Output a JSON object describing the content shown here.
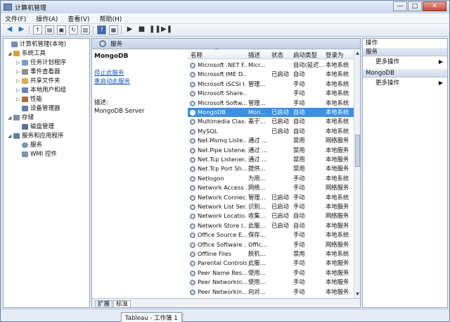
{
  "window": {
    "title": "计算机管理",
    "min": "—",
    "max": "□",
    "close": "✕"
  },
  "menu": [
    "文件(F)",
    "操作(A)",
    "查看(V)",
    "帮助(H)"
  ],
  "tree": [
    {
      "label": "计算机管理(本地)",
      "color": "#6d8bb8",
      "expander": ""
    },
    {
      "label": "系统工具",
      "color": "#d6a43c",
      "expander": "◢"
    },
    {
      "label": "任务计划程序",
      "color": "#7b9bcc",
      "expander": "▷"
    },
    {
      "label": "事件查看器",
      "color": "#8c8c8c",
      "expander": "▷"
    },
    {
      "label": "共享文件夹",
      "color": "#d3b14a",
      "expander": "▷"
    },
    {
      "label": "本地用户和组",
      "color": "#6b86b3",
      "expander": "▷"
    },
    {
      "label": "性能",
      "color": "#b06b3d",
      "expander": "▷"
    },
    {
      "label": "设备管理器",
      "color": "#5f7fa8",
      "expander": ""
    },
    {
      "label": "存储",
      "color": "#7e8fa6",
      "expander": "◢"
    },
    {
      "label": "磁盘管理",
      "color": "#5b7290",
      "expander": ""
    },
    {
      "label": "服务和应用程序",
      "color": "#6a7e9b",
      "expander": "◢"
    },
    {
      "label": "服务",
      "color": "#7f94ad",
      "expander": ""
    },
    {
      "label": "WMI 控件",
      "color": "#7f94ad",
      "expander": ""
    }
  ],
  "center": {
    "header": "服务",
    "selected_name": "MongoDB",
    "stop_link": "停止此服务",
    "restart_link": "重启动此服务",
    "desc_label": "描述:",
    "desc_value": "MongoDB Server",
    "columns": {
      "name": "名称",
      "desc": "描述",
      "status": "状态",
      "startup": "启动类型",
      "logon": "登录为"
    },
    "sort_indicator": "^",
    "rows": [
      {
        "name": "Microsoft .NET F...",
        "desc": "Micr...",
        "status": "",
        "startup": "自动(延迟...",
        "logon": "本地系统"
      },
      {
        "name": "Microsoft IME D...",
        "desc": "",
        "status": "已启动",
        "startup": "自动",
        "logon": "本地系统"
      },
      {
        "name": "Microsoft iSCSI I...",
        "desc": "管理...",
        "status": "",
        "startup": "手动",
        "logon": "本地系统"
      },
      {
        "name": "Microsoft Share...",
        "desc": "",
        "status": "",
        "startup": "手动",
        "logon": "本地系统"
      },
      {
        "name": "Microsoft Softw...",
        "desc": "管理...",
        "status": "",
        "startup": "手动",
        "logon": "本地系统"
      },
      {
        "name": "MongoDB",
        "desc": "Mon...",
        "status": "已启动",
        "startup": "自动",
        "logon": "本地系统",
        "selected": true
      },
      {
        "name": "Multimedia Clas...",
        "desc": "基于...",
        "status": "已启动",
        "startup": "自动",
        "logon": "本地系统"
      },
      {
        "name": "MySQL",
        "desc": "",
        "status": "已启动",
        "startup": "自动",
        "logon": "本地系统"
      },
      {
        "name": "Net.Msmq Liste...",
        "desc": "通过 ...",
        "status": "",
        "startup": "禁用",
        "logon": "网络服务"
      },
      {
        "name": "Net.Pipe Listene...",
        "desc": "通过 ...",
        "status": "",
        "startup": "禁用",
        "logon": "本地服务"
      },
      {
        "name": "Net.Tcp Listener...",
        "desc": "通过 ...",
        "status": "",
        "startup": "禁用",
        "logon": "本地服务"
      },
      {
        "name": "Net.Tcp Port Sh...",
        "desc": "提供...",
        "status": "",
        "startup": "禁用",
        "logon": "本地服务"
      },
      {
        "name": "Netlogon",
        "desc": "为用...",
        "status": "",
        "startup": "手动",
        "logon": "本地系统"
      },
      {
        "name": "Network Access ...",
        "desc": "网络...",
        "status": "",
        "startup": "手动",
        "logon": "网络服务"
      },
      {
        "name": "Network Connec...",
        "desc": "管理...",
        "status": "已启动",
        "startup": "手动",
        "logon": "本地系统"
      },
      {
        "name": "Network List Ser...",
        "desc": "识别...",
        "status": "已启动",
        "startup": "手动",
        "logon": "本地服务"
      },
      {
        "name": "Network Locatio...",
        "desc": "收集...",
        "status": "已启动",
        "startup": "自动",
        "logon": "网络服务"
      },
      {
        "name": "Network Store I...",
        "desc": "此服...",
        "status": "已启动",
        "startup": "自动",
        "logon": "本地服务"
      },
      {
        "name": "Office  Source E...",
        "desc": "保存...",
        "status": "",
        "startup": "手动",
        "logon": "本地系统"
      },
      {
        "name": "Office Software ...",
        "desc": "Offic...",
        "status": "",
        "startup": "手动",
        "logon": "网络服务"
      },
      {
        "name": "Offline Files",
        "desc": "脱机...",
        "status": "",
        "startup": "禁用",
        "logon": "本地系统"
      },
      {
        "name": "Parental Controls",
        "desc": "此服...",
        "status": "",
        "startup": "手动",
        "logon": "本地服务"
      },
      {
        "name": "Peer Name Res...",
        "desc": "使用...",
        "status": "",
        "startup": "手动",
        "logon": "本地服务"
      },
      {
        "name": "Peer Networkin...",
        "desc": "使用...",
        "status": "",
        "startup": "手动",
        "logon": "本地服务"
      },
      {
        "name": "Peer Networkin...",
        "desc": "向对...",
        "status": "",
        "startup": "手动",
        "logon": "本地服务"
      }
    ],
    "tabs": [
      "扩展",
      "标准"
    ]
  },
  "actions": {
    "title": "操作",
    "sections": [
      {
        "header": "服务",
        "items": [
          "更多操作"
        ]
      },
      {
        "header": "MongoDB",
        "items": [
          "更多操作"
        ]
      }
    ]
  },
  "tooltip": "Tableau - 工作簿 1",
  "colors": {
    "selection": "#3d8fe0",
    "link": "#1b59b4"
  }
}
